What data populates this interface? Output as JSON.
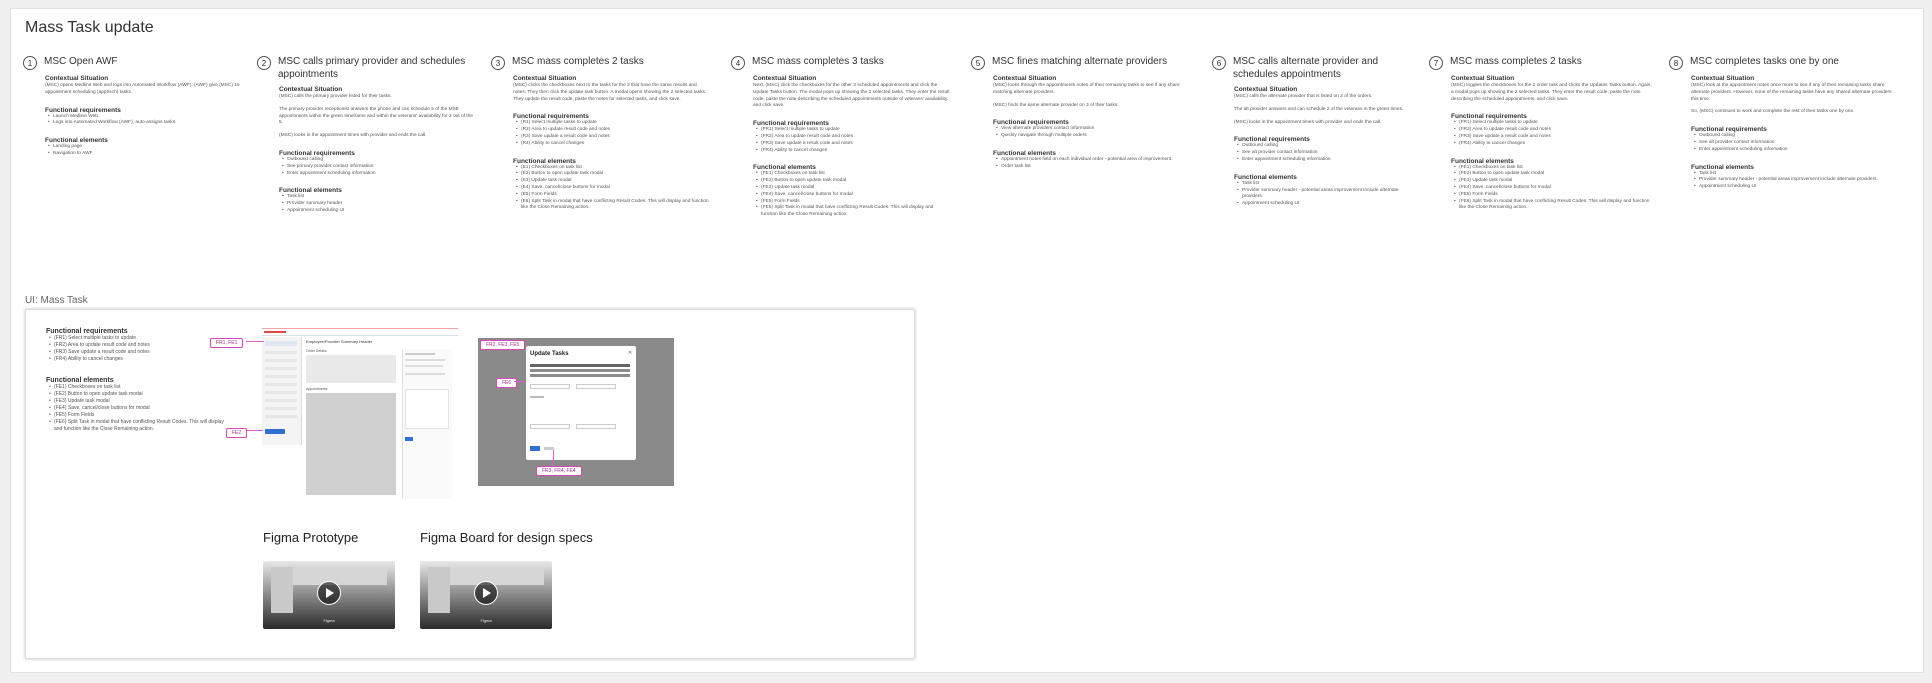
{
  "board": {
    "title": "Mass Task update"
  },
  "steps": [
    {
      "num": "1",
      "title": "MSC Open AWF",
      "sections": [
        {
          "heading": "Contextual Situation",
          "paras": [
            "(MSC) opens Medline Web and logs into Automated Workflow (AWF). (AWF) give (MSC) 15 appointment scheduling (appt/sch) tasks."
          ]
        },
        {
          "heading": "Functional requirements",
          "items": [
            "Launch Medline Web",
            "Logs into Automated Workflow (AWF), auto-assigns tasks."
          ]
        },
        {
          "heading": "Functional elements",
          "items": [
            "Landing page",
            "Navigation to AWF"
          ]
        }
      ]
    },
    {
      "num": "2",
      "title": "MSC calls primary provider and schedules appointments",
      "sections": [
        {
          "heading": "Contextual Situation",
          "paras": [
            "(MSC) calls the primary provider listed for their tasks.",
            "The primary provider receptionist answers the phone and can schedule 5 of the MSE appointments within the green timeframe and within the veterans' availability for 2 out of the 5.",
            "(MSC) looks in the appointment times with provider and ends the call."
          ]
        },
        {
          "heading": "Functional requirements",
          "items": [
            "Outbound calling",
            "See primary provider contact information",
            "Enter appointment scheduling information"
          ]
        },
        {
          "heading": "Functional elements",
          "items": [
            "Task list",
            "Provider summary header",
            "Appointment scheduling UI"
          ]
        }
      ]
    },
    {
      "num": "3",
      "title": "MSC mass completes 2 tasks",
      "sections": [
        {
          "heading": "Contextual Situation",
          "paras": [
            "(MSC) clicks the checkboxes next to the tasks for the 2 that have the same results and notes. They then click the update task button. A modal opens showing the 2 selected tasks. They update the result code, paste the notes for selected tasks, and click save."
          ]
        },
        {
          "heading": "Functional requirements",
          "items": [
            "(R1) Select multiple tasks to update",
            "(R2) Area to update result code and notes",
            "(R3) Save update a result code and notes",
            "(R4) Ability to cancel changes"
          ]
        },
        {
          "heading": "Functional elements",
          "items": [
            "(E1) Checkboxes on task list",
            "(E2) Button to open update task modal",
            "(E3) Update task modal",
            "(E4) Save, cancel/close buttons for modal",
            "(E5) Form Fields",
            "(E6) Split Task in modal that have conflicting Result Codes. This will display and function like the Close Remaining action."
          ]
        }
      ]
    },
    {
      "num": "4",
      "title": "MSC mass completes 3 tasks",
      "sections": [
        {
          "heading": "Contextual Situation",
          "paras": [
            "Next, (MSC) click the checkboxes for the other 3 scheduled appointments and click the Update Tasks button. The modal pops up showing the 3 selected tasks. They enter the result code, paste the note describing the scheduled appointments outside of veterans' availability, and click save."
          ]
        },
        {
          "heading": "Functional requirements",
          "items": [
            "(FR1) Select multiple tasks to update",
            "(FR2) Area to update result code and notes",
            "(FR3) Save update a result code and notes",
            "(FR4) Ability to cancel changes"
          ]
        },
        {
          "heading": "Functional elements",
          "items": [
            "(FE1) Checkboxes on task list",
            "(FE2) Button to open update task modal",
            "(FE3) Update task modal",
            "(FE4) Save, cancel/close buttons for modal",
            "(FE5) Form Fields",
            "(FE6) Split Task in modal that have conflicting Result Codes. This will display and function like the Close Remaining action."
          ]
        }
      ]
    },
    {
      "num": "5",
      "title": "MSC fines matching alternate providers",
      "sections": [
        {
          "heading": "Contextual Situation",
          "paras": [
            "(MSC) looks through the appointments notes of their remaining tasks to see if any share matching alternate providers.",
            "(MSC) finds the same alternate provider on 3 of their tasks."
          ]
        },
        {
          "heading": "Functional requirements",
          "items": [
            "View alternate providers contact information",
            "Quickly navigate through multiple orders"
          ]
        },
        {
          "heading": "Functional elements",
          "items": [
            "Appointment notes field on each individual order - potential area of improvement.",
            "Order task list"
          ]
        }
      ]
    },
    {
      "num": "6",
      "title": "MSC calls alternate provider and schedules appointments",
      "sections": [
        {
          "heading": "Contextual Situation",
          "paras": [
            "(MSC) calls the alternate provider that is listed on 3 of the orders.",
            "The alt provider answers and can schedule 2 of the veterans in the green times.",
            "(MSC) looks in the appointment times with provider and ends the call."
          ]
        },
        {
          "heading": "Functional requirements",
          "items": [
            "Outbound calling",
            "See alt provider contact information",
            "Enter appointment scheduling information"
          ]
        },
        {
          "heading": "Functional elements",
          "items": [
            "Task list",
            "Provider summary header - potential areas improvement include alternate providers.",
            "Appointment scheduling UI"
          ]
        }
      ]
    },
    {
      "num": "7",
      "title": "MSC mass completes 2 tasks",
      "sections": [
        {
          "heading": "Contextual Situation",
          "paras": [
            "(MSC) toggles the checkboxes for the 2 order task and clicks the Updates Tasks button. Again, a modal pops up showing the 2 selected tasks. They enter the result code, paste the note describing the scheduled appointments, and click save."
          ]
        },
        {
          "heading": "Functional requirements",
          "items": [
            "(FR1) Select multiple tasks to update",
            "(FR2) Area to update result code and notes",
            "(FR3) Save update a result code and notes",
            "(FR4) Ability to cancel changes"
          ]
        },
        {
          "heading": "Functional elements",
          "items": [
            "(FE1) Checkboxes on task list",
            "(FE2) Button to open update task modal",
            "(FE3) Update task modal",
            "(FE4) Save, cancel/close buttons for modal",
            "(FE5) Form Fields",
            "(FE6) Split Task in modal that have conflicting Result Codes. This will display and function like the Close Remaining action."
          ]
        }
      ]
    },
    {
      "num": "8",
      "title": "MSC completes tasks one by one",
      "sections": [
        {
          "heading": "Contextual Situation",
          "paras": [
            "(MSC) look at the appointment notes once more to see if any of their remaining tasks share alternate providers. However, none of the remaining tasks have any shared alternate providers this time.",
            "So, (MSC) continues to work and complete the rest of their tasks one by one."
          ]
        },
        {
          "heading": "Functional requirements",
          "items": [
            "Outbound calling",
            "See alt provider contact information",
            "Enter appointment scheduling information"
          ]
        },
        {
          "heading": "Functional elements",
          "items": [
            "Task list",
            "Provider summary header - potential areas improvement include alternate providers.",
            "Appointment scheduling UI"
          ]
        }
      ]
    }
  ],
  "ui_section": {
    "label": "UI: Mass Task",
    "req_heading": "Functional requirements",
    "reqs": [
      "(FR1) Select multiple tasks to update",
      "(FR2) Area to update result code and notes",
      "(FR3) Save update a result code and notes",
      "(FR4) Ability to cancel changes"
    ],
    "elem_heading": "Functional elements",
    "elems": [
      "(FE1) Checkboxes on task list",
      "(FE2) Button to open update task modal",
      "(FE3) Update task modal",
      "(FE4) Save, cancel/close buttons for modal",
      "(FE5) Form Fields",
      "(FE6) Split Task in modal that have conflicting Result Codes. This will display and function like the Close Remaining action."
    ],
    "shot1": {
      "header": "Employee/Provider Summary Header",
      "col_a": "Order Details",
      "col_b": "Appointments"
    },
    "shot2": {
      "modal_title": "Update Tasks"
    },
    "tags": {
      "fr1_fe1": "FR1, FE1",
      "fe2": "FE2",
      "fr2_fe5": "FR2, FE3, FE5",
      "fe6": "FE6",
      "fr3_fe4": "FR3, FR4, FE4"
    },
    "prototype_label": "Figma Prototype",
    "board_label": "Figma Board for design specs",
    "thumb_caption": "Figma"
  }
}
